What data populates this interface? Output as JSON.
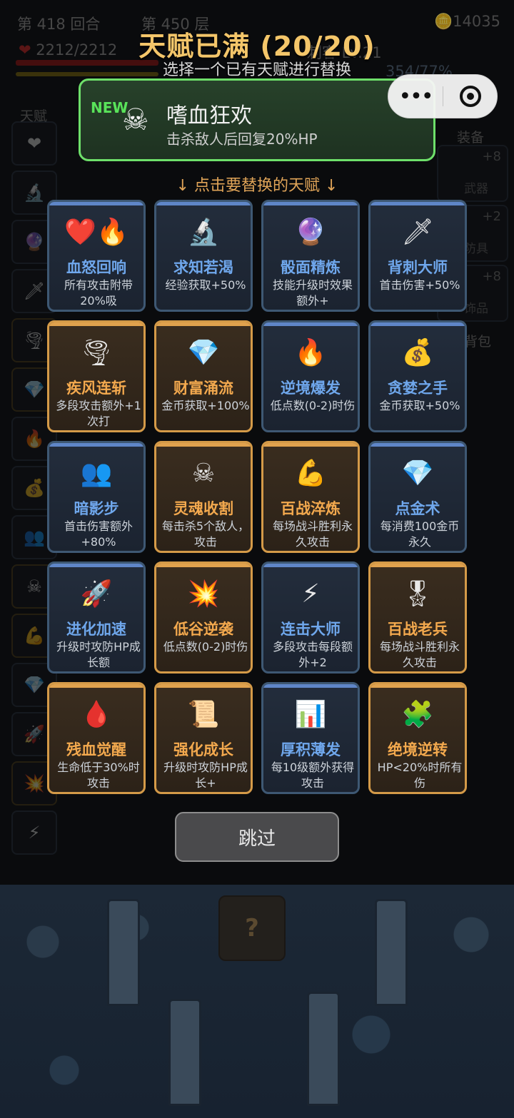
{
  "hud": {
    "round": "第 418 回合",
    "floor": "第 450 层",
    "gold": "14035",
    "hp": "2212/2212",
    "mid_label": "刺客 Lv.21",
    "exp_percent": "354/77%"
  },
  "side": {
    "left_label": "天赋",
    "right_label_equip": "装备",
    "weapon_plus": "+8",
    "weapon_label": "武器",
    "armor_plus": "+2",
    "armor_label": "防具",
    "acc_plus": "+8",
    "acc_label": "饰品",
    "bag_label": "背包"
  },
  "header": {
    "title": "天赋已满 (20/20)",
    "subtitle": "选择一个已有天赋进行替换"
  },
  "new_talent": {
    "tag": "NEW",
    "icon": "skull-crossbones-icon",
    "name": "嗜血狂欢",
    "desc": "击杀敌人后回复20%HP"
  },
  "hint": "↓ 点击要替换的天赋 ↓",
  "talents": [
    {
      "name": "血怒回响",
      "desc": "所有攻击附带20%吸",
      "tier": "blue",
      "icon": "heart-fire-icon",
      "glyph": "❤️🔥"
    },
    {
      "name": "求知若渴",
      "desc": "经验获取+50%",
      "tier": "blue",
      "icon": "microscope-icon",
      "glyph": "🔬"
    },
    {
      "name": "骰面精炼",
      "desc": "技能升级时效果额外+",
      "tier": "blue",
      "icon": "crystal-ball-icon",
      "glyph": "🔮"
    },
    {
      "name": "背刺大师",
      "desc": "首击伤害+50%",
      "tier": "blue",
      "icon": "dagger-icon",
      "glyph": "🗡"
    },
    {
      "name": "疾风连斩",
      "desc": "多段攻击额外+1次打",
      "tier": "gold",
      "icon": "tornado-icon",
      "glyph": "🌪"
    },
    {
      "name": "财富涌流",
      "desc": "金币获取+100%",
      "tier": "gold",
      "icon": "gem-icon",
      "glyph": "💎"
    },
    {
      "name": "逆境爆发",
      "desc": "低点数(0-2)时伤",
      "tier": "blue",
      "icon": "flame-icon",
      "glyph": "🔥"
    },
    {
      "name": "贪婪之手",
      "desc": "金币获取+50%",
      "tier": "blue",
      "icon": "money-bag-icon",
      "glyph": "💰"
    },
    {
      "name": "暗影步",
      "desc": "首击伤害额外+80%",
      "tier": "blue",
      "icon": "shadow-figures-icon",
      "glyph": "👥"
    },
    {
      "name": "灵魂收割",
      "desc": "每击杀5个敌人，攻击",
      "tier": "gold",
      "icon": "skull-icon",
      "glyph": "☠"
    },
    {
      "name": "百战淬炼",
      "desc": "每场战斗胜利永久攻击",
      "tier": "gold",
      "icon": "flexed-arm-icon",
      "glyph": "💪"
    },
    {
      "name": "点金术",
      "desc": "每消费100金币永久",
      "tier": "blue",
      "icon": "gem-icon",
      "glyph": "💎"
    },
    {
      "name": "进化加速",
      "desc": "升级时攻防HP成长额",
      "tier": "blue",
      "icon": "rocket-icon",
      "glyph": "🚀"
    },
    {
      "name": "低谷逆袭",
      "desc": "低点数(0-2)时伤",
      "tier": "gold",
      "icon": "explosion-icon",
      "glyph": "💥"
    },
    {
      "name": "连击大师",
      "desc": "多段攻击每段额外+2",
      "tier": "blue",
      "icon": "lightning-icon",
      "glyph": "⚡"
    },
    {
      "name": "百战老兵",
      "desc": "每场战斗胜利永久攻击",
      "tier": "gold",
      "icon": "medal-icon",
      "glyph": "🎖"
    },
    {
      "name": "残血觉醒",
      "desc": "生命低于30%时攻击",
      "tier": "gold",
      "icon": "blood-drop-icon",
      "glyph": "🩸"
    },
    {
      "name": "强化成长",
      "desc": "升级时攻防HP成长+",
      "tier": "gold",
      "icon": "scroll-icon",
      "glyph": "📜"
    },
    {
      "name": "厚积薄发",
      "desc": "每10级额外获得攻击",
      "tier": "blue",
      "icon": "chart-icon",
      "glyph": "📊"
    },
    {
      "name": "绝境逆转",
      "desc": "HP<20%时所有伤",
      "tier": "gold",
      "icon": "grid-items-icon",
      "glyph": "🧩"
    }
  ],
  "skip_label": "跳过",
  "mystery_glyph": "?"
}
